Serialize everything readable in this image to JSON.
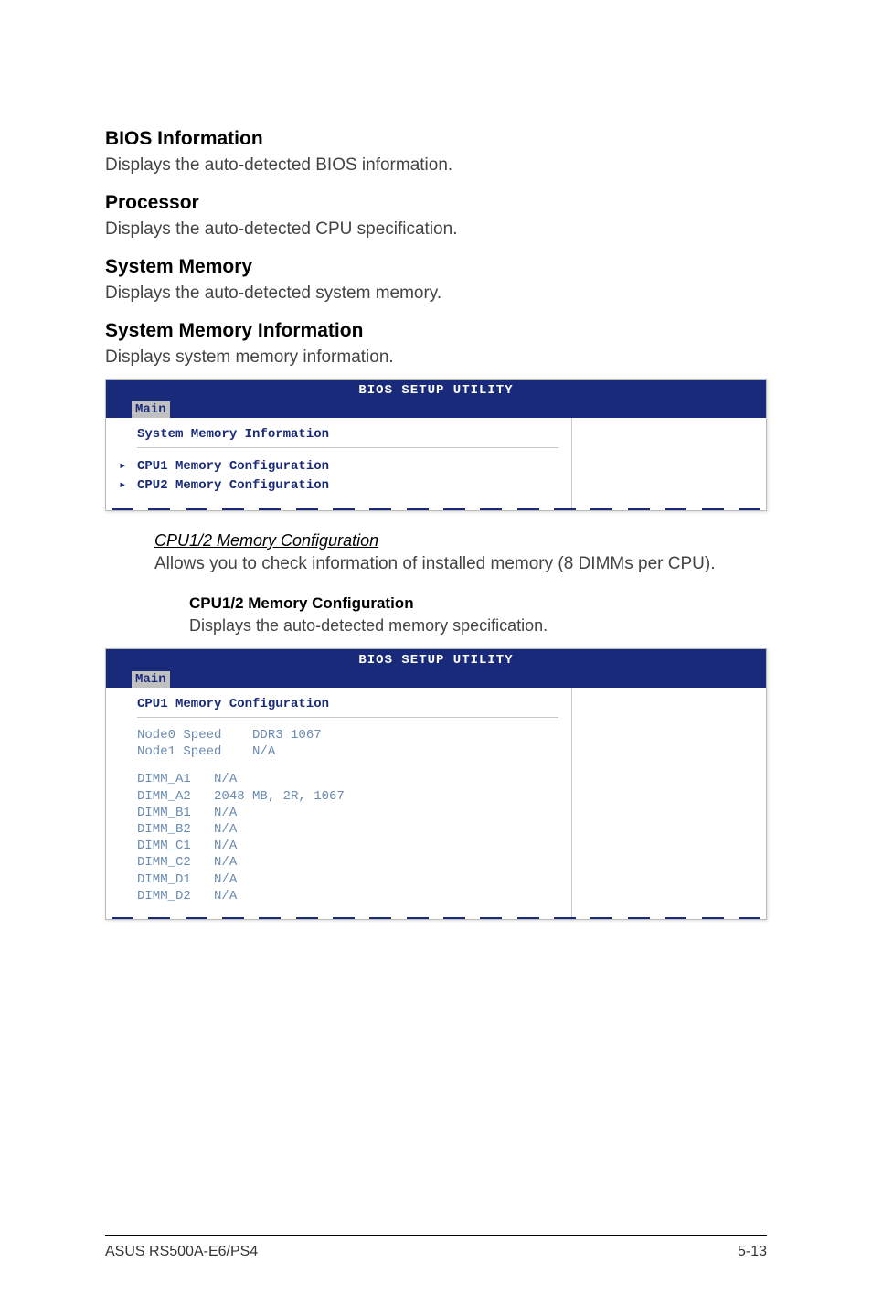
{
  "sections": {
    "bios_info": {
      "heading": "BIOS Information",
      "body": "Displays the auto-detected BIOS information."
    },
    "processor": {
      "heading": "Processor",
      "body": "Displays the auto-detected CPU specification."
    },
    "system_memory": {
      "heading": "System Memory",
      "body": "Displays the auto-detected system memory."
    },
    "system_memory_info": {
      "heading": "System Memory Information",
      "body": "Displays system memory information."
    }
  },
  "bios_box1": {
    "header_title": "BIOS SETUP UTILITY",
    "tab": "Main",
    "section_title": "System Memory Information",
    "items": [
      "CPU1 Memory Configuration",
      "CPU2 Memory Configuration"
    ]
  },
  "cpu_config": {
    "heading": "CPU1/2 Memory Configuration",
    "body": "Allows you to check information of installed memory (8 DIMMs per CPU)."
  },
  "cpu_config_sub": {
    "heading": "CPU1/2 Memory Configuration",
    "body": "Displays the auto-detected memory specification."
  },
  "bios_box2": {
    "header_title": "BIOS SETUP UTILITY",
    "tab": "Main",
    "section_title": "CPU1 Memory Configuration",
    "node_rows": [
      "Node0 Speed    DDR3 1067",
      "Node1 Speed    N/A"
    ],
    "dimm_rows": [
      "DIMM_A1   N/A",
      "DIMM_A2   2048 MB, 2R, 1067",
      "DIMM_B1   N/A",
      "DIMM_B2   N/A",
      "DIMM_C1   N/A",
      "DIMM_C2   N/A",
      "DIMM_D1   N/A",
      "DIMM_D2   N/A"
    ]
  },
  "chart_data": {
    "type": "table",
    "title": "CPU1 Memory Configuration",
    "nodes": [
      {
        "name": "Node0 Speed",
        "value": "DDR3 1067"
      },
      {
        "name": "Node1 Speed",
        "value": "N/A"
      }
    ],
    "dimms": [
      {
        "slot": "DIMM_A1",
        "value": "N/A"
      },
      {
        "slot": "DIMM_A2",
        "value": "2048 MB, 2R, 1067"
      },
      {
        "slot": "DIMM_B1",
        "value": "N/A"
      },
      {
        "slot": "DIMM_B2",
        "value": "N/A"
      },
      {
        "slot": "DIMM_C1",
        "value": "N/A"
      },
      {
        "slot": "DIMM_C2",
        "value": "N/A"
      },
      {
        "slot": "DIMM_D1",
        "value": "N/A"
      },
      {
        "slot": "DIMM_D2",
        "value": "N/A"
      }
    ]
  },
  "footer": {
    "left": "ASUS RS500A-E6/PS4",
    "right": "5-13"
  }
}
